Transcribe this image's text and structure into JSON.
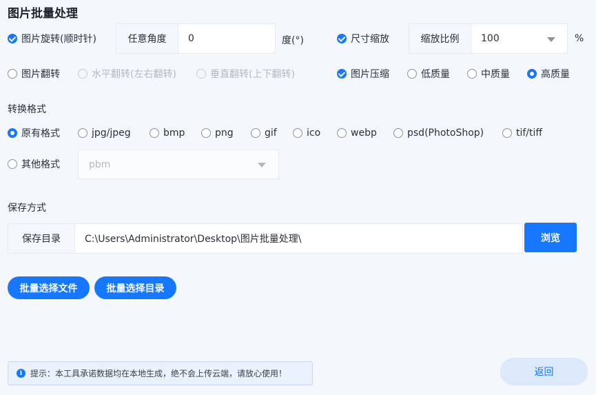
{
  "page_title": "图片批量处理",
  "row1": {
    "rotate_label": "图片旋转(顺时针)",
    "angle_label": "任意角度",
    "angle_value": "0",
    "angle_unit": "度(°)",
    "resize_label": "尺寸缩放",
    "scale_label": "缩放比例",
    "scale_value": "100",
    "scale_unit": "%"
  },
  "row2": {
    "flip_label": "图片翻转",
    "flip_h_label": "水平翻转(左右翻转)",
    "flip_v_label": "垂直翻转(上下翻转)",
    "compress_label": "图片压缩",
    "quality_low": "低质量",
    "quality_mid": "中质量",
    "quality_high": "高质量"
  },
  "format": {
    "section_label": "转换格式",
    "options": [
      "原有格式",
      "jpg/jpeg",
      "bmp",
      "png",
      "gif",
      "ico",
      "webp",
      "psd(PhotoShop)",
      "tif/tiff"
    ],
    "other_label": "其他格式",
    "other_value": "pbm"
  },
  "save": {
    "section_label": "保存方式",
    "dir_label": "保存目录",
    "dir_value": "C:\\Users\\Administrator\\Desktop\\图片批量处理\\",
    "browse_label": "浏览"
  },
  "actions": {
    "select_files": "批量选择文件",
    "select_dir": "批量选择目录"
  },
  "footer": {
    "tip_icon": "i",
    "tip_text": "提示：本工具承诺数据均在本地生成，绝不会上传云端，请放心使用！",
    "back_label": "返回"
  },
  "colors": {
    "accent": "#1677ff",
    "background": "#f4f7fc"
  }
}
